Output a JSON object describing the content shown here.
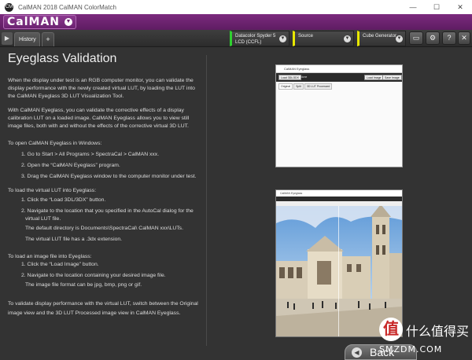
{
  "window": {
    "title": "CalMAN 2018 CalMAN ColorMatch",
    "app_icon": "CM",
    "controls": [
      "—",
      "☐",
      "✕"
    ]
  },
  "brand": {
    "logo_text": "CalMAN"
  },
  "toolbar": {
    "tabs": [
      {
        "label": "History 1"
      },
      {
        "label": "+"
      }
    ],
    "dropdowns": [
      {
        "line1": "Datacolor Spyder 5",
        "line2": "LCD (CCFL)",
        "accent": "#2fd12f"
      },
      {
        "line1": "Source",
        "line2": "",
        "accent": "#e8e800"
      },
      {
        "line1": "Cube Generator",
        "line2": "",
        "accent": "#e8e800"
      }
    ],
    "icons": [
      "display-icon",
      "gear-icon",
      "help-icon",
      "close-icon"
    ]
  },
  "content": {
    "title": "Eyeglass Validation",
    "p1": [
      "When the display under test is an RGB computer monitor, you can validate the",
      "display performance with the newly created virtual LUT, by loading the LUT into",
      "the CalMAN Eyeglass 3D LUT Visualization Tool."
    ],
    "p2": [
      "With CalMAN Eyeglass, you can validate the corrective effects of a display",
      "calibration LUT on a loaded image.  CalMAN Eyeglass allows you to view still",
      "image files, both with and without the effects of the corrective virtual 3D LUT."
    ],
    "open_heading": "To open CalMAN Eyeglass in Windows:",
    "open_steps": [
      "1.   Go to Start > All Programs > SpectraCal > CalMAN xxx.",
      "2.   Open the “CalMAN Eyeglass” program.",
      "3.   Drag the CalMAN Eyeglass window to the computer monitor under test."
    ],
    "load_lut_heading": "To load the virtual LUT into Eyeglass:",
    "load_lut_steps": [
      "1.  Click the “Load 3DL/3DX” button.",
      "2.   Navigate to the location that you specified in the AutoCal dialog for the",
      "virtual LUT file.",
      "The default directory is Documents\\SpectraCal\\ CalMAN xxx\\LUTs.",
      "The virtual LUT file has a .3dx extension."
    ],
    "load_img_heading": "To load an image file into Eyeglass:",
    "load_img_steps": [
      "1.  Click the “Load Image” button.",
      "2.   Navigate to the location containing your desired image file.",
      "The image file format can be jpg, bmp, png or gif."
    ],
    "closing": [
      "To validate display performance with the virtual LUT, switch between the Original",
      "image view and the 3D LUT Processed image view in CalMAN Eyeglass."
    ]
  },
  "eyeglass_shot": {
    "title": "CalMAN Eyeglass",
    "load_btn": "Load 3DL/3DX",
    "none_label": "None",
    "load_image_btn": "Load Image",
    "save_image_btn": "Save Image",
    "tabs": [
      "Original",
      "Split",
      "3D LUT Processed"
    ]
  },
  "watermark": {
    "symbol": "值",
    "zh": "什么值得买",
    "en": "SMZDM.COM"
  },
  "back_button": {
    "label": "Back",
    "icon": "back-arrow-icon"
  }
}
